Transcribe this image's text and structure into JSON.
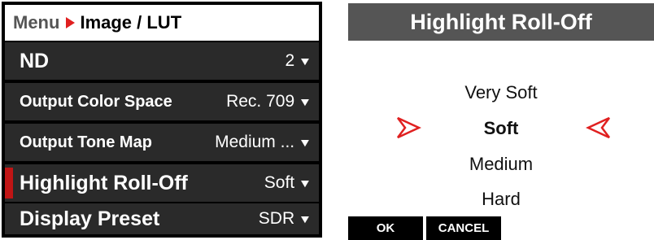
{
  "menu": {
    "breadcrumb": {
      "root": "Menu",
      "current": "Image / LUT"
    },
    "items": [
      {
        "label": "ND",
        "value": "2"
      },
      {
        "label": "Output Color Space",
        "value": "Rec. 709"
      },
      {
        "label": "Output Tone Map",
        "value": "Medium ..."
      },
      {
        "label": "Highlight Roll-Off",
        "value": "Soft"
      },
      {
        "label": "Display Preset",
        "value": "SDR"
      }
    ],
    "caret": "▼",
    "selected_index": 3,
    "selected_marker_color": "#c01515"
  },
  "dialog": {
    "title": "Highlight Roll-Off",
    "options": [
      "Very Soft",
      "Soft",
      "Medium",
      "Hard"
    ],
    "selected": "Soft",
    "arrow_color": "#e02020",
    "buttons": {
      "ok": "OK",
      "cancel": "CANCEL"
    }
  }
}
